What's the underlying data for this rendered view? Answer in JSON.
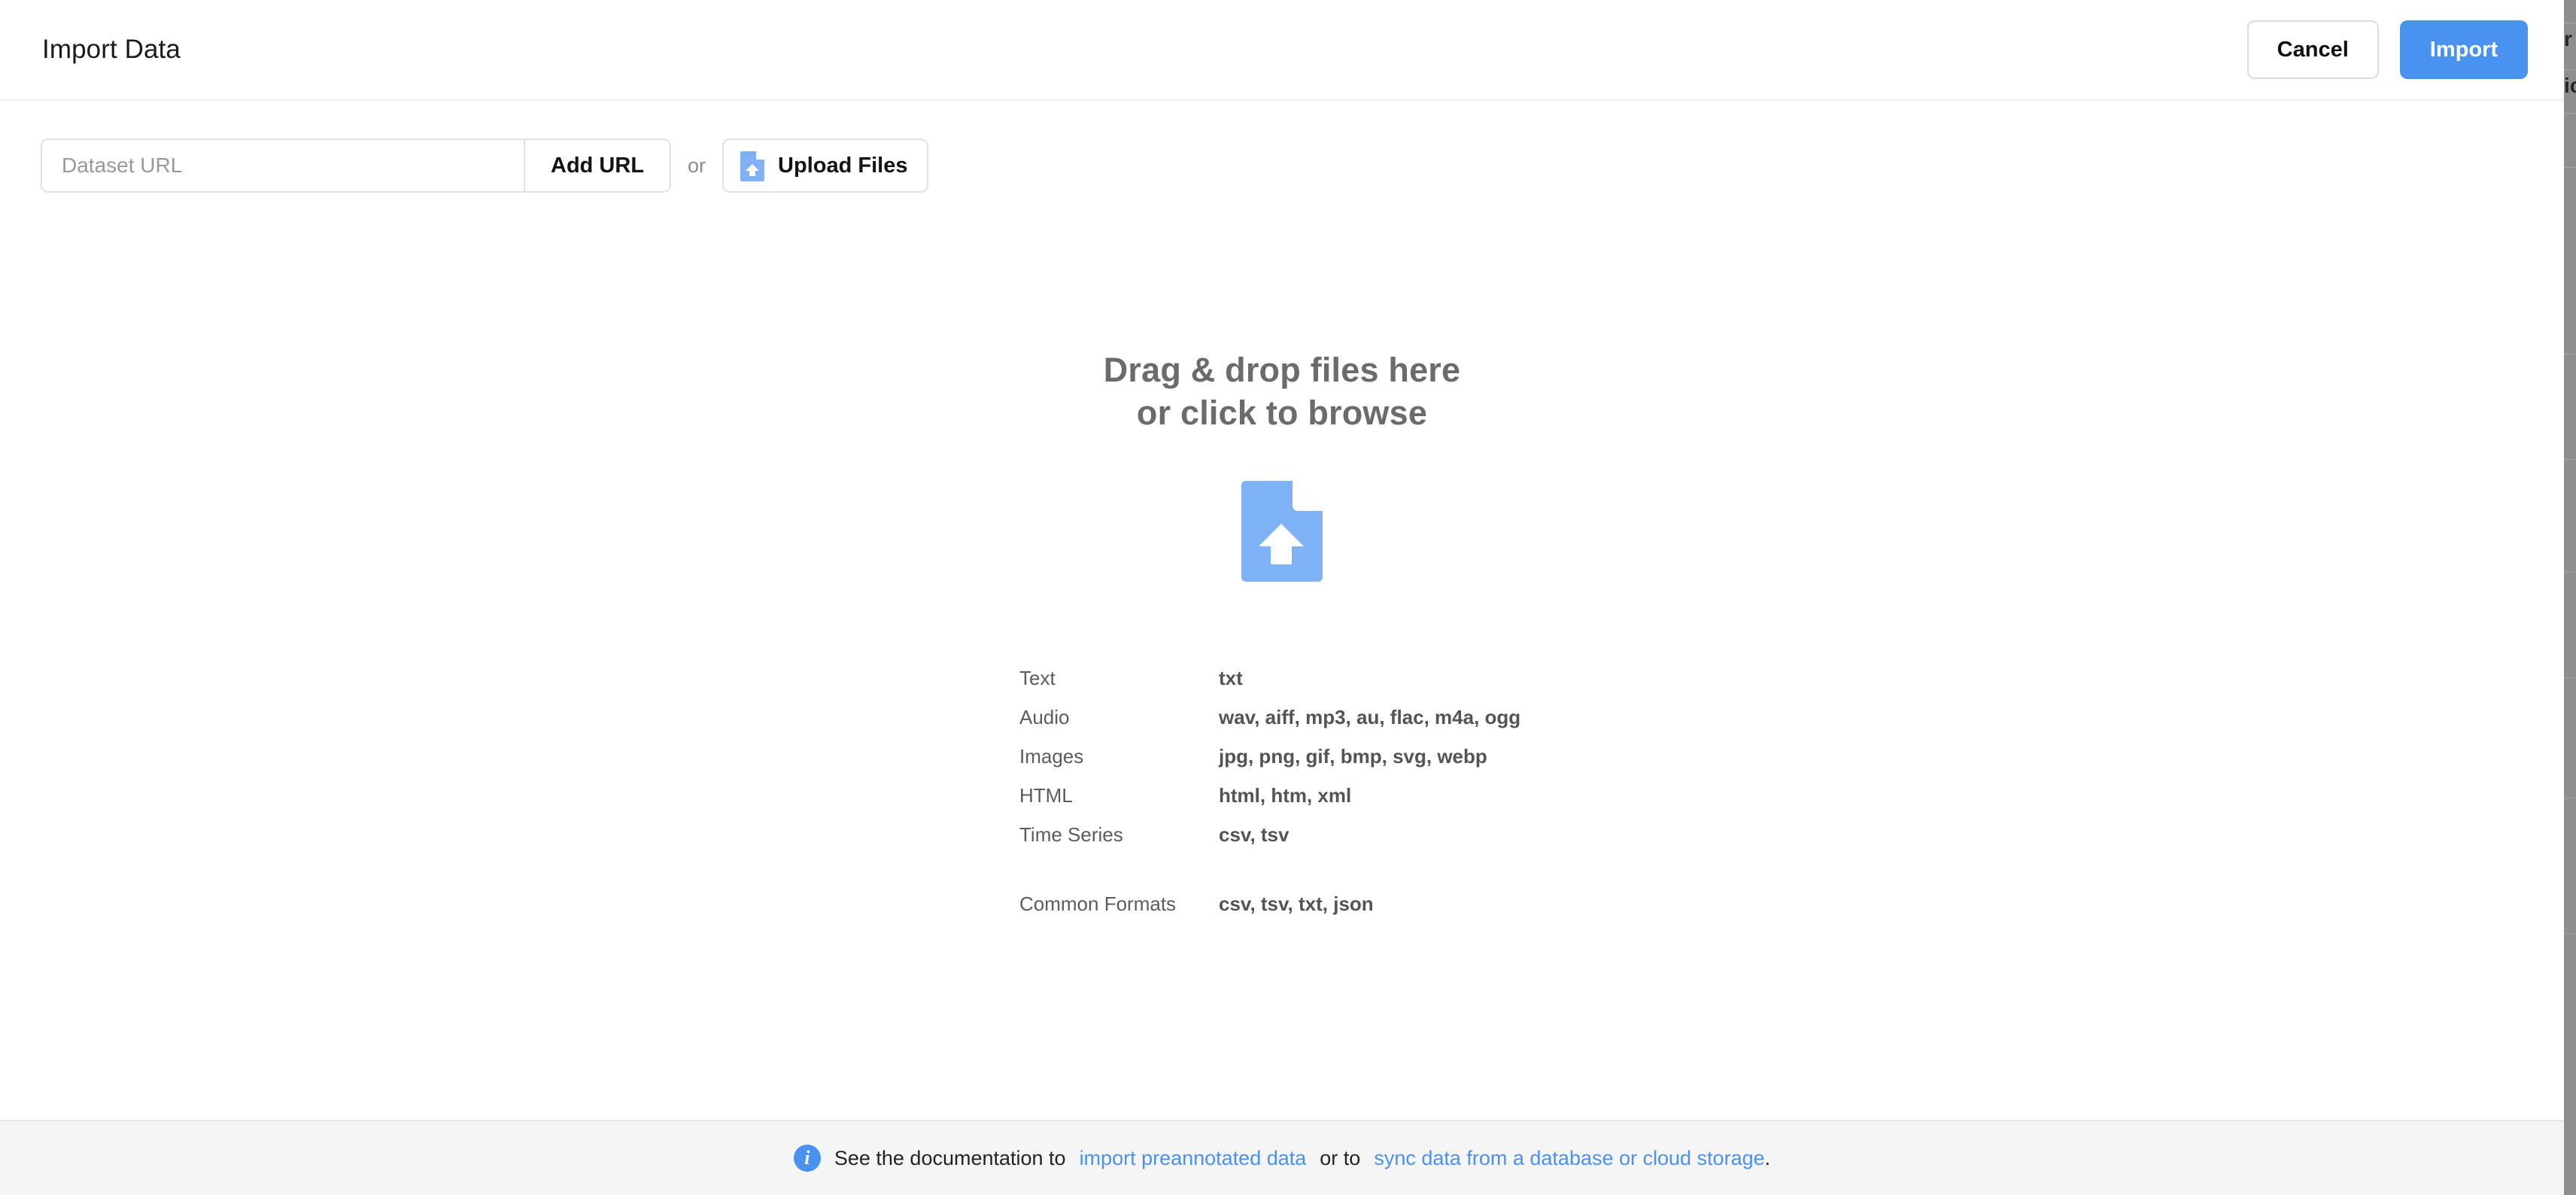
{
  "header": {
    "title": "Import Data",
    "cancel_label": "Cancel",
    "import_label": "Import",
    "import_button_color": "#4a92ef"
  },
  "url_row": {
    "input_placeholder": "Dataset URL",
    "input_value": "",
    "add_url_label": "Add URL",
    "or_label": "or",
    "upload_files_label": "Upload Files",
    "upload_icon": "file-upload-icon",
    "icon_color": "#7fb2f5"
  },
  "dropzone": {
    "title_line1": "Drag & drop files here",
    "title_line2": "or click to browse",
    "icon": "file-upload-icon",
    "icon_color": "#7fb2f5",
    "title_color": "#6b6b6b"
  },
  "formats": {
    "rows": [
      {
        "label": "Text",
        "value": "txt"
      },
      {
        "label": "Audio",
        "value": "wav, aiff, mp3, au, flac, m4a, ogg"
      },
      {
        "label": "Images",
        "value": "jpg, png, gif, bmp, svg, webp"
      },
      {
        "label": "HTML",
        "value": "html, htm, xml"
      },
      {
        "label": "Time Series",
        "value": "csv, tsv"
      }
    ],
    "common": {
      "label": "Common Formats",
      "value": "csv, tsv, txt, json"
    }
  },
  "footer": {
    "info_icon": "info-circle-icon",
    "text_before": "See the documentation to",
    "link1": "import preannotated data",
    "text_middle": "or to",
    "link2": "sync data from a database or cloud storage",
    "text_after": ".",
    "link_color": "#4a92ef",
    "background": "#f5f5f6"
  },
  "backdrop": {
    "fragment_top": "r",
    "fragment_bottom": "ic"
  }
}
